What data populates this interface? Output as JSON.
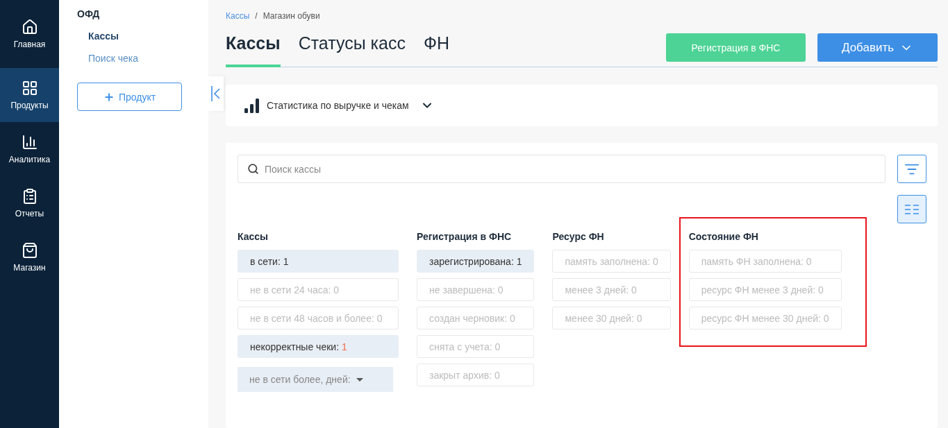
{
  "nav": [
    {
      "label": "Главная",
      "selected": false
    },
    {
      "label": "Продукты",
      "selected": true
    },
    {
      "label": "Аналитика",
      "selected": false
    },
    {
      "label": "Отчеты",
      "selected": false
    },
    {
      "label": "Магазин",
      "selected": false
    }
  ],
  "sidebar": {
    "title": "ОФД",
    "items": [
      {
        "label": "Кассы",
        "selected": true
      },
      {
        "label": "Поиск чека",
        "selected": false
      }
    ],
    "button": "Продукт"
  },
  "breadcrumbs": {
    "separator": "/",
    "items": [
      {
        "label": "Кассы",
        "link": true
      },
      {
        "label": "Магазин обуви",
        "link": false
      }
    ]
  },
  "tabs": [
    {
      "label": "Кассы",
      "selected": true
    },
    {
      "label": "Статусы касс",
      "selected": false
    },
    {
      "label": "ФН",
      "selected": false
    }
  ],
  "actions": [
    {
      "label": "Регистрация в ФНС",
      "kind": "green"
    },
    {
      "label": "Добавить",
      "kind": "dropdown"
    }
  ],
  "stats": {
    "label": "Статистика по выручке и чекам"
  },
  "search": {
    "placeholder": "Поиск кассы"
  },
  "filter_groups": [
    {
      "title": "Кассы",
      "highlighted": false,
      "chips": [
        {
          "kind": "chip",
          "label": "в сети:",
          "count": "1",
          "active": true,
          "alert": false
        },
        {
          "kind": "chip",
          "label": "не в сети 24 часа:",
          "count": "0",
          "active": false,
          "alert": false
        },
        {
          "kind": "chip",
          "label": "не в сети 48 часов и более:",
          "count": "0",
          "active": false,
          "alert": false
        },
        {
          "kind": "chip",
          "label": "некорректные чеки:",
          "count": "1",
          "active": true,
          "alert": true
        },
        {
          "kind": "dropdown",
          "label": "не в сети более, дней:"
        }
      ]
    },
    {
      "title": "Регистрация в ФНС",
      "highlighted": false,
      "chips": [
        {
          "kind": "chip",
          "label": "зарегистрирована:",
          "count": "1",
          "active": true,
          "alert": false
        },
        {
          "kind": "chip",
          "label": "не завершена:",
          "count": "0",
          "active": false,
          "alert": false
        },
        {
          "kind": "chip",
          "label": "создан черновик:",
          "count": "0",
          "active": false,
          "alert": false
        },
        {
          "kind": "chip",
          "label": "снята с учета:",
          "count": "0",
          "active": false,
          "alert": false
        },
        {
          "kind": "chip",
          "label": "закрыт архив:",
          "count": "0",
          "active": false,
          "alert": false
        }
      ]
    },
    {
      "title": "Ресурс ФН",
      "highlighted": false,
      "chips": [
        {
          "kind": "chip",
          "label": "память заполнена:",
          "count": "0",
          "active": false,
          "alert": false
        },
        {
          "kind": "chip",
          "label": "менее 3 дней:",
          "count": "0",
          "active": false,
          "alert": false
        },
        {
          "kind": "chip",
          "label": "менее 30 дней:",
          "count": "0",
          "active": false,
          "alert": false
        }
      ]
    },
    {
      "title": "Состояние ФН",
      "highlighted": true,
      "chips": [
        {
          "kind": "chip",
          "label": "память ФН заполнена:",
          "count": "0",
          "active": false,
          "alert": false
        },
        {
          "kind": "chip",
          "label": "ресурс ФН менее 3 дней:",
          "count": "0",
          "active": false,
          "alert": false
        },
        {
          "kind": "chip",
          "label": "ресурс ФН менее 30 дней:",
          "count": "0",
          "active": false,
          "alert": false
        }
      ]
    }
  ]
}
